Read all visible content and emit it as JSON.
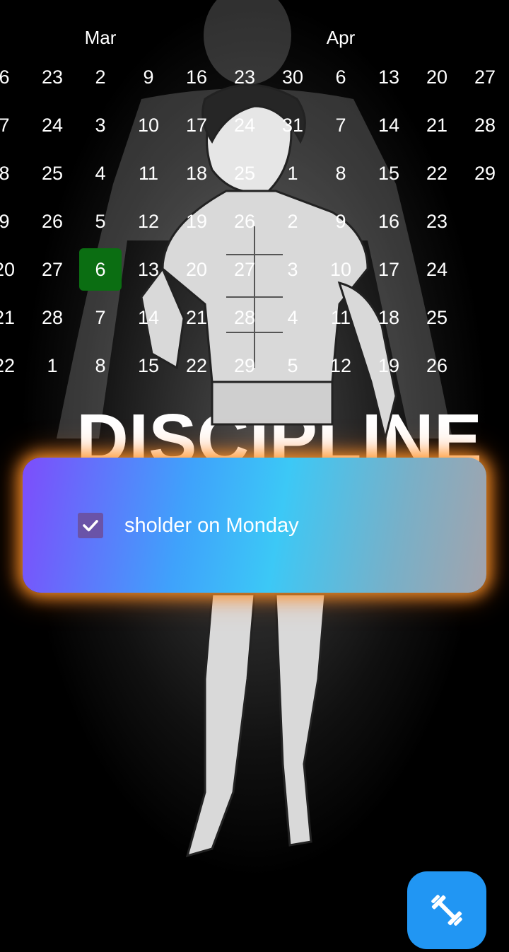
{
  "calendar": {
    "months": [
      {
        "label": "Mar",
        "col": 2
      },
      {
        "label": "Apr",
        "col": 7
      }
    ],
    "columns": [
      {
        "days": [
          "6",
          "7",
          "8",
          "9",
          "20",
          "21",
          "22"
        ]
      },
      {
        "days": [
          "23",
          "24",
          "25",
          "26",
          "27",
          "28",
          "1"
        ]
      },
      {
        "days": [
          "2",
          "3",
          "4",
          "5",
          "6",
          "7",
          "8"
        ]
      },
      {
        "days": [
          "9",
          "10",
          "11",
          "12",
          "13",
          "14",
          "15"
        ]
      },
      {
        "days": [
          "16",
          "17",
          "18",
          "19",
          "20",
          "21",
          "22"
        ]
      },
      {
        "days": [
          "23",
          "24",
          "25",
          "26",
          "27",
          "28",
          "29"
        ]
      },
      {
        "days": [
          "30",
          "31",
          "1",
          "2",
          "3",
          "4",
          "5"
        ]
      },
      {
        "days": [
          "6",
          "7",
          "8",
          "9",
          "10",
          "11",
          "12"
        ]
      },
      {
        "days": [
          "13",
          "14",
          "15",
          "16",
          "17",
          "18",
          "19"
        ]
      },
      {
        "days": [
          "20",
          "21",
          "22",
          "23",
          "24",
          "25",
          "26"
        ]
      },
      {
        "days": [
          "27",
          "28",
          "29"
        ]
      }
    ],
    "today": {
      "col": 2,
      "row": 4
    },
    "today_color": "#0b6e12"
  },
  "task": {
    "label": "sholder on Monday",
    "checked": true,
    "check_icon": "check-icon"
  },
  "fab": {
    "icon": "dumbbell-icon",
    "color": "#2196f3"
  },
  "background": {
    "figure": "muscular-anime-fighter-illustration",
    "banner_text": "DISCIPLINE"
  }
}
